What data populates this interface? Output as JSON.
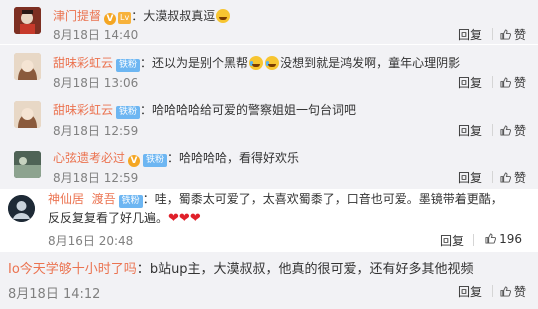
{
  "comments": [
    {
      "user": "津门提督",
      "colon": "：",
      "text": "大漠叔叔真逗",
      "time": "8月18日 14:40",
      "reply": "回复",
      "like": "赞"
    },
    {
      "user": "甜味彩虹云",
      "fan_badge": "铁粉",
      "colon": "：",
      "text_a": "还以为是别个黑帮",
      "text_b": "没想到就是鸿发啊，童年心理阴影",
      "time": "8月18日 13:06",
      "reply": "回复",
      "like": "赞"
    },
    {
      "user": "甜味彩虹云",
      "fan_badge": "铁粉",
      "colon": "：",
      "text": "哈哈哈哈给可爱的警察姐姐一句台词吧",
      "time": "8月18日 12:59",
      "reply": "回复",
      "like": "赞"
    },
    {
      "user": "心弦遗考必过",
      "fan_badge": "铁粉",
      "colon": "：",
      "text": "哈哈哈哈，看得好欢乐",
      "time": "8月18日 12:59",
      "reply": "回复",
      "like": "赞"
    },
    {
      "user_a": "神仙居",
      "user_b": "渡吾",
      "fan_badge": "铁粉",
      "colon": "：",
      "text_line1": "哇，蜀黍太可爱了，太喜欢蜀黍了，口音也可爱。墨镜带着更酷，",
      "text_line2": "反反复复看了好几遍。",
      "time": "8月16日 20:48",
      "reply": "回复",
      "like_count": "196"
    },
    {
      "user": "Io今天学够十小时了吗",
      "colon": "：",
      "text": "b站up主，大漠叔叔，他真的很可爱，还有好多其他视频",
      "time": "8月18日 14:12",
      "reply": "回复",
      "like": "赞"
    }
  ],
  "icons": {
    "v_badge": "V",
    "level_badge": "Lv"
  },
  "colors": {
    "username": "#eb7350",
    "fan_badge": "#6db6f2",
    "v_badge": "#f4a623",
    "heart": "#e0202a"
  }
}
